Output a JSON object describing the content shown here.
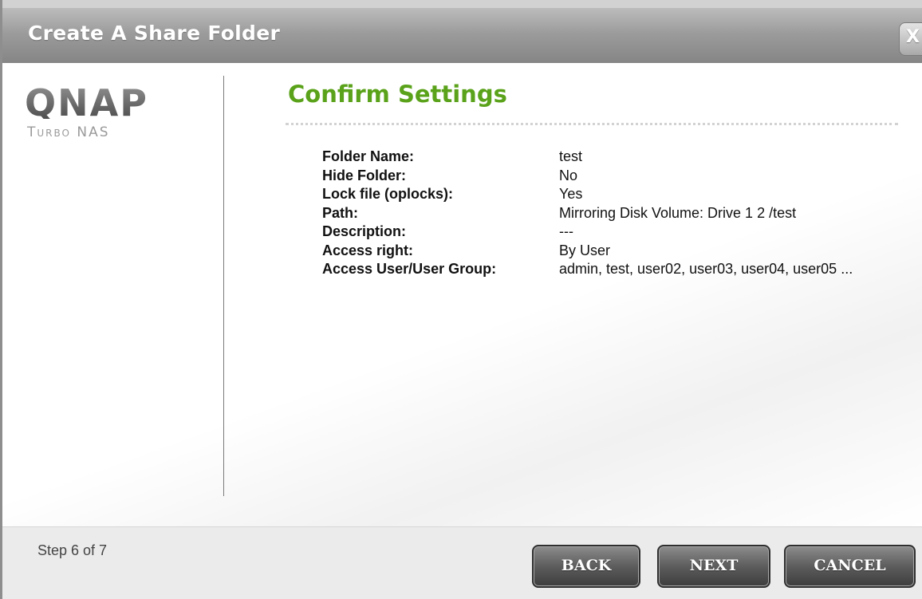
{
  "window": {
    "title": "Create A Share Folder",
    "close_label": "X"
  },
  "branding": {
    "logo": "QNAP",
    "logo_sub": "Turbo NAS"
  },
  "main": {
    "heading": "Confirm Settings",
    "settings": [
      {
        "label": "Folder Name:",
        "value": "test"
      },
      {
        "label": "Hide Folder:",
        "value": "No"
      },
      {
        "label": "Lock file (oplocks):",
        "value": "Yes"
      },
      {
        "label": "Path:",
        "value": "Mirroring Disk Volume: Drive 1 2 /test"
      },
      {
        "label": "Description:",
        "value": "---"
      },
      {
        "label": "Access right:",
        "value": "By User"
      },
      {
        "label": "Access User/User Group:",
        "value": "admin, test, user02, user03, user04, user05 ..."
      }
    ]
  },
  "footer": {
    "step": "Step 6 of 7",
    "back_label": "BACK",
    "next_label": "NEXT",
    "cancel_label": "CANCEL"
  },
  "colors": {
    "heading": "#5aa21a",
    "titlebar": "#9c9c9c",
    "button": "#5d5d5d"
  }
}
